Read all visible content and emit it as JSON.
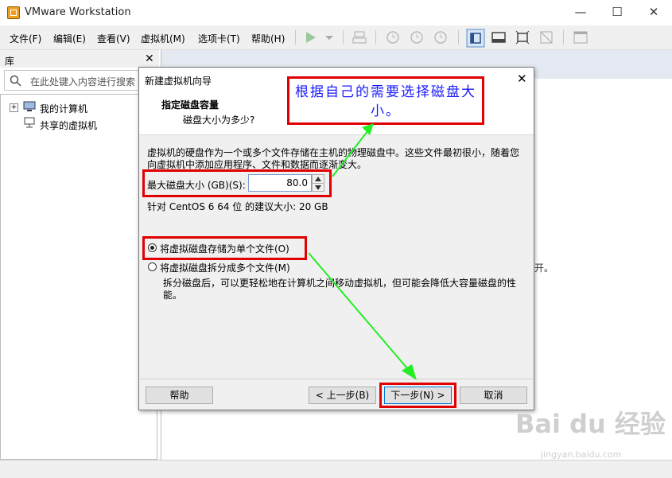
{
  "app": {
    "title": "VMware Workstation"
  },
  "menu": [
    "文件(F)",
    "编辑(E)",
    "查看(V)",
    "虚拟机(M)",
    "选项卡(T)",
    "帮助(H)"
  ],
  "library": {
    "title": "库",
    "search_placeholder": "在此处键入内容进行搜索",
    "tree": [
      "我的计算机",
      "共享的虚拟机"
    ]
  },
  "dialog": {
    "title": "新建虚拟机向导",
    "heading": "指定磁盘容量",
    "subheading": "磁盘大小为多少?",
    "description": "虚拟机的硬盘作为一个或多个文件存储在主机的物理磁盘中。这些文件最初很小，随着您向虚拟机中添加应用程序、文件和数据而逐渐变大。",
    "disk_size_label": "最大磁盘大小 (GB)(S):",
    "disk_size_value": "80.0",
    "recommended": "针对 CentOS 6 64 位 的建议大小: 20 GB",
    "option_single": "将虚拟磁盘存储为单个文件(O)",
    "option_split": "将虚拟磁盘拆分成多个文件(M)",
    "split_note": "拆分磁盘后，可以更轻松地在计算机之间移动虚拟机，但可能会降低大容量磁盘的性能。",
    "buttons": {
      "help": "帮助",
      "back": "< 上一步(B)",
      "next": "下一步(N) >",
      "cancel": "取消"
    }
  },
  "annotation": {
    "callout": "根据自己的需要选择磁盘大小。"
  },
  "background_text": "开。",
  "watermark": {
    "brand": "Bai du 经验",
    "url": "jingyan.baidu.com"
  },
  "colors": {
    "highlight_red": "#e00000",
    "arrow_green": "#22ee22",
    "callout_text": "#1a1aff"
  }
}
